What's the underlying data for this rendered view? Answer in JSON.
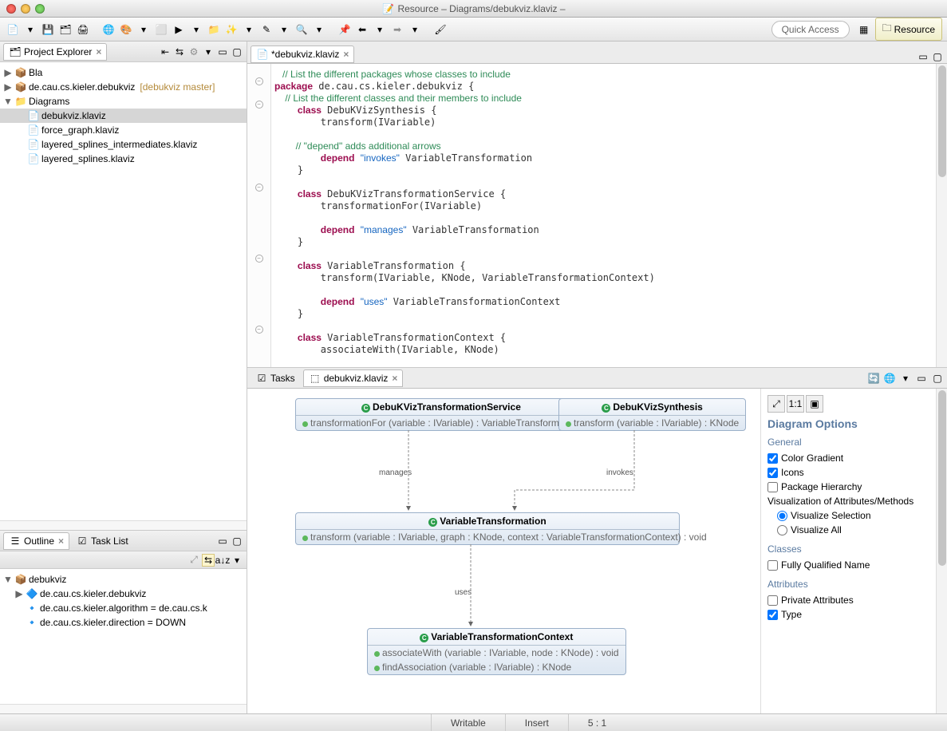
{
  "title": "Resource – Diagrams/debukviz.klaviz –",
  "quick_access": "Quick Access",
  "perspective_label": "Resource",
  "explorer": {
    "tab": "Project Explorer",
    "items": [
      {
        "name": "Bla",
        "type": "project"
      },
      {
        "name": "de.cau.cs.kieler.debukviz",
        "type": "project",
        "branch": "[debukviz master]"
      },
      {
        "name": "Diagrams",
        "type": "folder",
        "expanded": true,
        "children": [
          {
            "name": "debukviz.klaviz",
            "selected": true
          },
          {
            "name": "force_graph.klaviz"
          },
          {
            "name": "layered_splines_intermediates.klaviz"
          },
          {
            "name": "layered_splines.klaviz"
          }
        ]
      }
    ]
  },
  "editor": {
    "tab": "*debukviz.klaviz",
    "code_lines": [
      {
        "t": "   // List the different packages whose classes to include",
        "cls": "cmt"
      },
      {
        "t": "package de.cau.cs.kieler.debukviz {",
        "spans": [
          [
            "package",
            "kw"
          ]
        ]
      },
      {
        "t": "    // List the different classes and their members to include",
        "cls": "cmt"
      },
      {
        "t": "    class DebuKVizSynthesis {",
        "spans": [
          [
            "class",
            "kw"
          ]
        ]
      },
      {
        "t": "        transform(IVariable)"
      },
      {
        "t": ""
      },
      {
        "t": "        // \"depend\" adds additional arrows",
        "cls": "cmt"
      },
      {
        "t": "        depend \"invokes\" VariableTransformation",
        "spans": [
          [
            "depend",
            "kw"
          ],
          [
            "\"invokes\"",
            "str"
          ]
        ]
      },
      {
        "t": "    }"
      },
      {
        "t": ""
      },
      {
        "t": "    class DebuKVizTransformationService {",
        "spans": [
          [
            "class",
            "kw"
          ]
        ]
      },
      {
        "t": "        transformationFor(IVariable)"
      },
      {
        "t": ""
      },
      {
        "t": "        depend \"manages\" VariableTransformation",
        "spans": [
          [
            "depend",
            "kw"
          ],
          [
            "\"manages\"",
            "str"
          ]
        ]
      },
      {
        "t": "    }"
      },
      {
        "t": ""
      },
      {
        "t": "    class VariableTransformation {",
        "spans": [
          [
            "class",
            "kw"
          ]
        ]
      },
      {
        "t": "        transform(IVariable, KNode, VariableTransformationContext)"
      },
      {
        "t": ""
      },
      {
        "t": "        depend \"uses\" VariableTransformationContext",
        "spans": [
          [
            "depend",
            "kw"
          ],
          [
            "\"uses\"",
            "str"
          ]
        ]
      },
      {
        "t": "    }"
      },
      {
        "t": ""
      },
      {
        "t": "    class VariableTransformationContext {",
        "spans": [
          [
            "class",
            "kw"
          ]
        ]
      },
      {
        "t": "        associateWith(IVariable, KNode)"
      }
    ]
  },
  "outline": {
    "tab": "Outline",
    "tasklist": "Task List",
    "root": "debukviz",
    "children": [
      "de.cau.cs.kieler.debukviz",
      "de.cau.cs.kieler.algorithm = de.cau.cs.k",
      "de.cau.cs.kieler.direction = DOWN"
    ]
  },
  "bottom": {
    "tasks_tab": "Tasks",
    "diagram_tab": "debukviz.klaviz",
    "nodes": {
      "svc": {
        "title": "DebuKVizTransformationService",
        "rows": [
          "transformationFor (variable : IVariable) : VariableTransformation"
        ]
      },
      "syn": {
        "title": "DebuKVizSynthesis",
        "rows": [
          "transform (variable : IVariable) : KNode"
        ]
      },
      "vt": {
        "title": "VariableTransformation",
        "rows": [
          "transform (variable : IVariable, graph : KNode, context : VariableTransformationContext) : void"
        ]
      },
      "ctx": {
        "title": "VariableTransformationContext",
        "rows": [
          "associateWith (variable : IVariable, node : KNode) : void",
          "findAssociation (variable : IVariable) : KNode"
        ]
      }
    },
    "edges": {
      "manages": "manages",
      "invokes": "invokes",
      "uses": "uses"
    }
  },
  "options": {
    "title": "Diagram Options",
    "general": "General",
    "color_gradient": "Color Gradient",
    "icons": "Icons",
    "package_hierarchy": "Package Hierarchy",
    "viz_attr_label": "Visualization of Attributes/Methods",
    "viz_sel": "Visualize Selection",
    "viz_all": "Visualize All",
    "classes": "Classes",
    "fqn": "Fully Qualified Name",
    "attributes": "Attributes",
    "private_attr": "Private Attributes",
    "type": "Type"
  },
  "status": {
    "writable": "Writable",
    "insert": "Insert",
    "pos": "5 : 1"
  }
}
